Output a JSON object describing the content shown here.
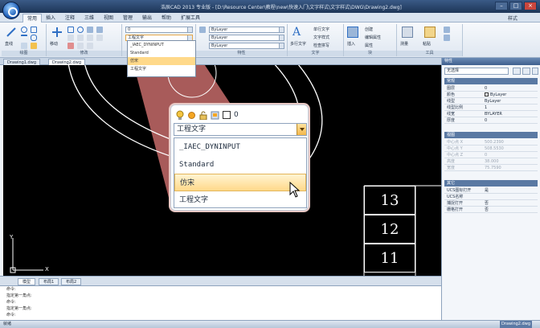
{
  "titlebar": {
    "title": "浩辰CAD 2013 专业版 - [D:\\Resource Center\\教程\\new\\快速入门\\文字样式\\文字样式\\DWG\\Drawing2.dwg]",
    "controls": [
      "–",
      "□",
      "×"
    ]
  },
  "ribbon_tabs": [
    "常用",
    "插入",
    "注释",
    "三维",
    "视图",
    "管理",
    "输出",
    "帮助",
    "扩展工具"
  ],
  "style_label": "样式",
  "ribbon": {
    "groups": [
      "绘图",
      "修改",
      "图层",
      "特性",
      "文字",
      "块",
      "工具"
    ],
    "line_label": "直线",
    "move_label": "移动",
    "text_label": "多行文字",
    "insert_label": "插入",
    "measure_label": "测量",
    "paste_label": "粘贴",
    "layer_value": "0",
    "textstyle_value": "工程文字",
    "color_value": "ByLayer",
    "linetype_value": "ByLayer",
    "lineweight_value": "ByLayer",
    "text_items": [
      "单行文字",
      "文字样式",
      "检查拼写"
    ],
    "block_items": [
      "创建",
      "编辑属性",
      "属性"
    ]
  },
  "mini_dropdown": {
    "items": [
      "_IAEC_DYNINPUT",
      "Standard",
      "仿宋",
      "工程文字"
    ],
    "highlighted": "仿宋"
  },
  "doc_tabs": [
    "Drawing1.dwg",
    "Drawing2.dwg"
  ],
  "callout": {
    "layer_name": "0",
    "current": "工程文字",
    "items": [
      "_IAEC_DYNINPUT",
      "Standard",
      "仿宋",
      "工程文字"
    ],
    "highlighted": "仿宋"
  },
  "canvas": {
    "table_numbers": [
      "13",
      "12",
      "11"
    ],
    "axis_y": "Y",
    "axis_x": "X"
  },
  "layout_tabs": [
    "模型",
    "布局1",
    "布局2"
  ],
  "command_lines": [
    "命令:",
    "指定第一角点:",
    "命令:",
    "指定第一角点:",
    "命令:"
  ],
  "status_left": "就绪",
  "status_right": "Drawing2.dwg",
  "properties": {
    "title": "特性",
    "selection": "无选择",
    "sections": {
      "general": {
        "title": "常规",
        "rows": [
          {
            "k": "图层",
            "v": "0"
          },
          {
            "k": "颜色",
            "v": "ByLayer"
          },
          {
            "k": "线型",
            "v": "ByLayer"
          },
          {
            "k": "线型比例",
            "v": "1"
          },
          {
            "k": "线宽",
            "v": "BYLAYER"
          },
          {
            "k": "厚度",
            "v": "0"
          }
        ]
      },
      "view": {
        "title": "视图",
        "rows": [
          {
            "k": "中心点 X",
            "v": "500.2390"
          },
          {
            "k": "中心点 Y",
            "v": "508.5530"
          },
          {
            "k": "中心点 Z",
            "v": "0"
          },
          {
            "k": "高度",
            "v": "38.000"
          },
          {
            "k": "宽度",
            "v": "75.7590"
          }
        ]
      },
      "misc": {
        "title": "其它",
        "rows": [
          {
            "k": "UCS图标打开",
            "v": "是"
          },
          {
            "k": "UCS名称",
            "v": ""
          },
          {
            "k": "捕捉打开",
            "v": "否"
          },
          {
            "k": "栅格打开",
            "v": "否"
          }
        ]
      }
    }
  },
  "colors": {
    "highlight": "#ffd98a",
    "callout_beam": "#e07a78",
    "ribbon_accent": "#2f6fc4"
  }
}
